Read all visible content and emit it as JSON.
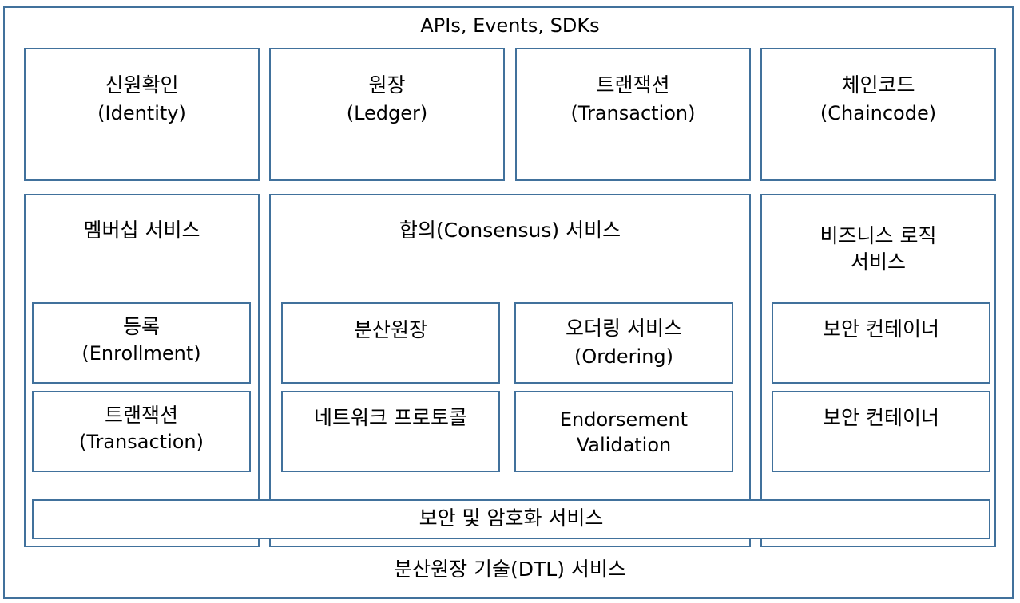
{
  "diagram": {
    "top_label": "APIs, Events, SDKs",
    "bottom_label": "분산원장 기술(DTL) 서비스",
    "concepts": [
      {
        "title": "신원확인",
        "subtitle": "(Identity)"
      },
      {
        "title": "원장",
        "subtitle": "(Ledger)"
      },
      {
        "title": "트랜잭션",
        "subtitle": "(Transaction)"
      },
      {
        "title": "체인코드",
        "subtitle": "(Chaincode)"
      }
    ],
    "membership": {
      "title": "멤버십 서비스",
      "enrollment": {
        "title": "등록",
        "subtitle": "(Enrollment)"
      },
      "transaction": {
        "title": "트랜잭션",
        "subtitle": "(Transaction)"
      }
    },
    "consensus": {
      "title": "합의(Consensus) 서비스",
      "ledger": "분산원장",
      "ordering": {
        "title": "오더링 서비스",
        "subtitle": "(Ordering)"
      },
      "network": "네트워크 프로토콜",
      "endorsement": {
        "line1": "Endorsement",
        "line2": "Validation"
      }
    },
    "business": {
      "title_line1": "비즈니스 로직",
      "title_line2": "서비스",
      "container1": "보안 컨테이너",
      "container2": "보안 컨테이너"
    },
    "security_bar": "보안 및 암호화 서비스",
    "colors": {
      "border": "#41719c",
      "background": "#ffffff",
      "text": "#000000"
    }
  }
}
